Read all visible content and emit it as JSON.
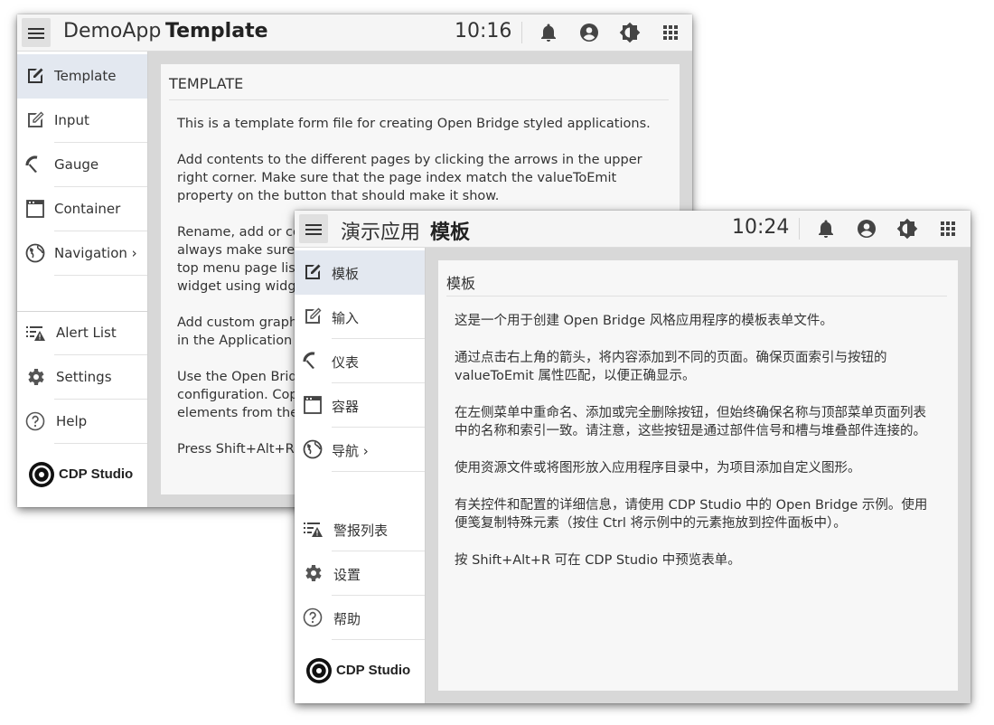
{
  "colors": {
    "active_nav": "#e3e8f0",
    "content_bg": "#d8d8d8",
    "card_bg": "#f7f7f7",
    "topbar_bg": "#f5f5f5"
  },
  "windows": [
    {
      "app_name": "DemoApp",
      "page_name": "Template",
      "clock": "10:16",
      "topbar_icons": [
        "bell-icon",
        "account-icon",
        "brightness-icon",
        "apps-grid-icon"
      ],
      "nav_items": [
        {
          "label": "Template",
          "icon": "edit-icon",
          "active": true
        },
        {
          "label": "Input",
          "icon": "edit-outline-icon"
        },
        {
          "label": "Gauge",
          "icon": "gauge-icon"
        },
        {
          "label": "Container",
          "icon": "window-icon"
        },
        {
          "label": "Navigation ›",
          "icon": "globe-icon"
        }
      ],
      "bottom_items": [
        {
          "label": "Alert List",
          "icon": "alert-list-icon"
        },
        {
          "label": "Settings",
          "icon": "gear-icon"
        },
        {
          "label": "Help",
          "icon": "help-icon"
        }
      ],
      "logo_text": "CDP Studio",
      "card_title": "TEMPLATE",
      "paragraphs": [
        "This is a template form file for creating Open Bridge styled applications.",
        "Add contents to the different pages by clicking the arrows in the upper right corner. Make sure that the page index match the valueToEmit property on the button that should make it show.",
        "Rename, add or co",
        "always make sure t",
        "top menu page list",
        "widget using widge",
        "Add custom graphi",
        "in the Application d",
        "Use the Open Bridg",
        "configuration. Copy",
        "elements from the",
        "Press Shift+Alt+R to"
      ]
    },
    {
      "app_name": "演示应用",
      "page_name": "模板",
      "clock": "10:24",
      "topbar_icons": [
        "bell-icon",
        "account-icon",
        "brightness-icon",
        "apps-grid-icon"
      ],
      "nav_items": [
        {
          "label": "模板",
          "icon": "edit-icon",
          "active": true
        },
        {
          "label": "输入",
          "icon": "edit-outline-icon"
        },
        {
          "label": "仪表",
          "icon": "gauge-icon"
        },
        {
          "label": "容器",
          "icon": "window-icon"
        },
        {
          "label": "导航 ›",
          "icon": "globe-icon"
        }
      ],
      "bottom_items": [
        {
          "label": "警报列表",
          "icon": "alert-list-icon"
        },
        {
          "label": "设置",
          "icon": "gear-icon"
        },
        {
          "label": "帮助",
          "icon": "help-icon"
        }
      ],
      "logo_text": "CDP Studio",
      "card_title": "模板",
      "paragraphs": [
        "这是一个用于创建 Open Bridge 风格应用程序的模板表单文件。",
        "通过点击右上角的箭头，将内容添加到不同的页面。确保页面索引与按钮的 valueToEmit 属性匹配，以便正确显示。",
        "在左侧菜单中重命名、添加或完全删除按钮，但始终确保名称与顶部菜单页面列表中的名称和索引一致。请注意，这些按钮是通过部件信号和槽与堆叠部件连接的。",
        "使用资源文件或将图形放入应用程序目录中，为项目添加自定义图形。",
        "有关控件和配置的详细信息，请使用 CDP Studio 中的 Open Bridge 示例。使用便笺复制特殊元素（按住 Ctrl 将示例中的元素拖放到控件面板中）。",
        "按 Shift+Alt+R 可在 CDP Studio 中预览表单。"
      ]
    }
  ]
}
